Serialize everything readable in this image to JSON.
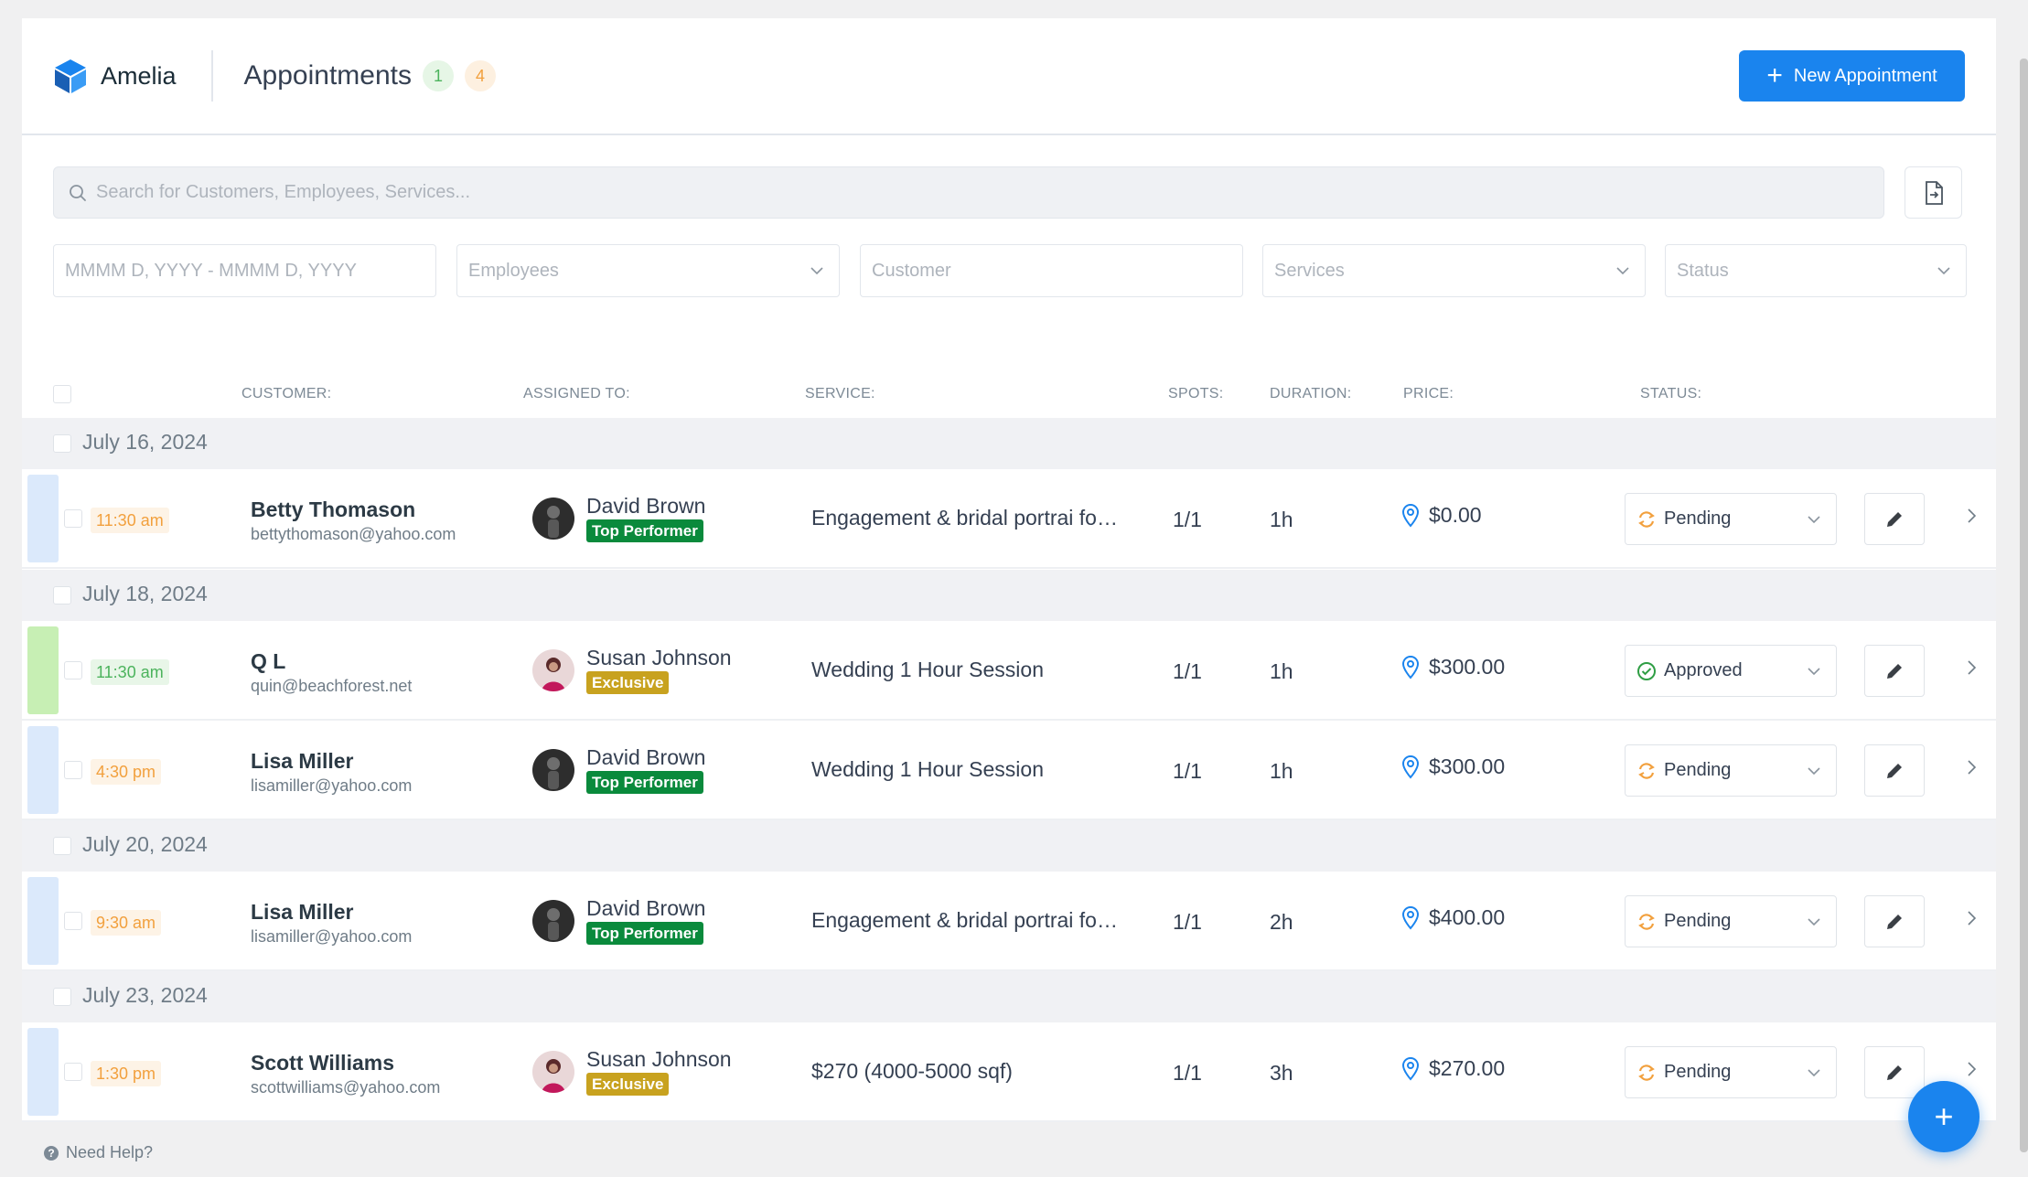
{
  "header": {
    "logo_text": "Amelia",
    "title": "Appointments",
    "count_approved": "1",
    "count_pending": "4",
    "new_button_label": "New Appointment"
  },
  "search": {
    "placeholder": "Search for Customers, Employees, Services..."
  },
  "filters": {
    "date_placeholder": "MMMM D, YYYY - MMMM D, YYYY",
    "employees_placeholder": "Employees",
    "customer_placeholder": "Customer",
    "services_placeholder": "Services",
    "status_placeholder": "Status"
  },
  "columns": {
    "customer": "CUSTOMER:",
    "assigned": "ASSIGNED TO:",
    "service": "SERVICE:",
    "spots": "SPOTS:",
    "duration": "DURATION:",
    "price": "PRICE:",
    "status": "STATUS:"
  },
  "groups": [
    {
      "date": "July 16, 2024",
      "appointments": [
        {
          "time": "11:30 am",
          "customer": "Betty Thomason",
          "email": "bettythomason@yahoo.com",
          "employee": "David Brown",
          "tag": "Top Performer",
          "service": "Engagement & bridal portrai for…",
          "spots": "1/1",
          "duration": "1h",
          "price": "$0.00",
          "status": "Pending"
        }
      ]
    },
    {
      "date": "July 18, 2024",
      "appointments": [
        {
          "time": "11:30 am",
          "customer": "Q L",
          "email": "quin@beachforest.net",
          "employee": "Susan Johnson",
          "tag": "Exclusive",
          "service": "Wedding 1 Hour Session",
          "spots": "1/1",
          "duration": "1h",
          "price": "$300.00",
          "status": "Approved"
        },
        {
          "time": "4:30 pm",
          "customer": "Lisa Miller",
          "email": "lisamiller@yahoo.com",
          "employee": "David Brown",
          "tag": "Top Performer",
          "service": "Wedding 1 Hour Session",
          "spots": "1/1",
          "duration": "1h",
          "price": "$300.00",
          "status": "Pending"
        }
      ]
    },
    {
      "date": "July 20, 2024",
      "appointments": [
        {
          "time": "9:30 am",
          "customer": "Lisa Miller",
          "email": "lisamiller@yahoo.com",
          "employee": "David Brown",
          "tag": "Top Performer",
          "service": "Engagement & bridal portrai for…",
          "spots": "1/1",
          "duration": "2h",
          "price": "$400.00",
          "status": "Pending"
        }
      ]
    },
    {
      "date": "July 23, 2024",
      "appointments": [
        {
          "time": "1:30 pm",
          "customer": "Scott Williams",
          "email": "scottwilliams@yahoo.com",
          "employee": "Susan Johnson",
          "tag": "Exclusive",
          "service": "$270 (4000-5000 sqf)",
          "spots": "1/1",
          "duration": "3h",
          "price": "$270.00",
          "status": "Pending"
        }
      ]
    }
  ],
  "footer": {
    "help_label": "Need Help?"
  },
  "colors": {
    "accent": "#1a84ee",
    "pending": "#f2a03d",
    "approved": "#4bb35c",
    "top_performer_tag": "#0a8a3c",
    "exclusive_tag": "#c8a21f"
  }
}
